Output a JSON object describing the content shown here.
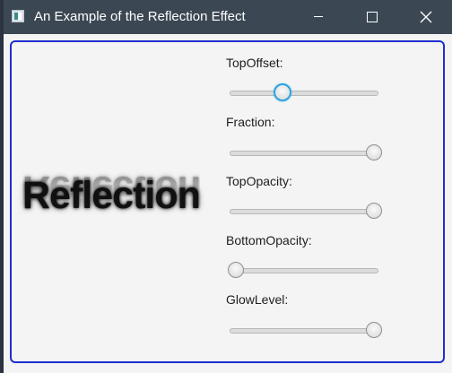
{
  "window": {
    "title": "An Example of the Reflection Effect"
  },
  "icons": {
    "app": "app-window-icon",
    "minimize": "minimize-icon",
    "maximize": "maximize-icon",
    "close": "close-icon"
  },
  "colors": {
    "titlebar": "#3b4753",
    "focus_border": "#1f2fd0",
    "slider_focus": "#2aa3dc"
  },
  "reflection": {
    "text": "Reflection"
  },
  "controls": [
    {
      "label": "TopOffset:",
      "value": 0.33,
      "focused": true
    },
    {
      "label": "Fraction:",
      "value": 1.0,
      "focused": false
    },
    {
      "label": "TopOpacity:",
      "value": 1.0,
      "focused": false
    },
    {
      "label": "BottomOpacity:",
      "value": 0.0,
      "focused": false
    },
    {
      "label": "GlowLevel:",
      "value": 1.0,
      "focused": false
    }
  ]
}
